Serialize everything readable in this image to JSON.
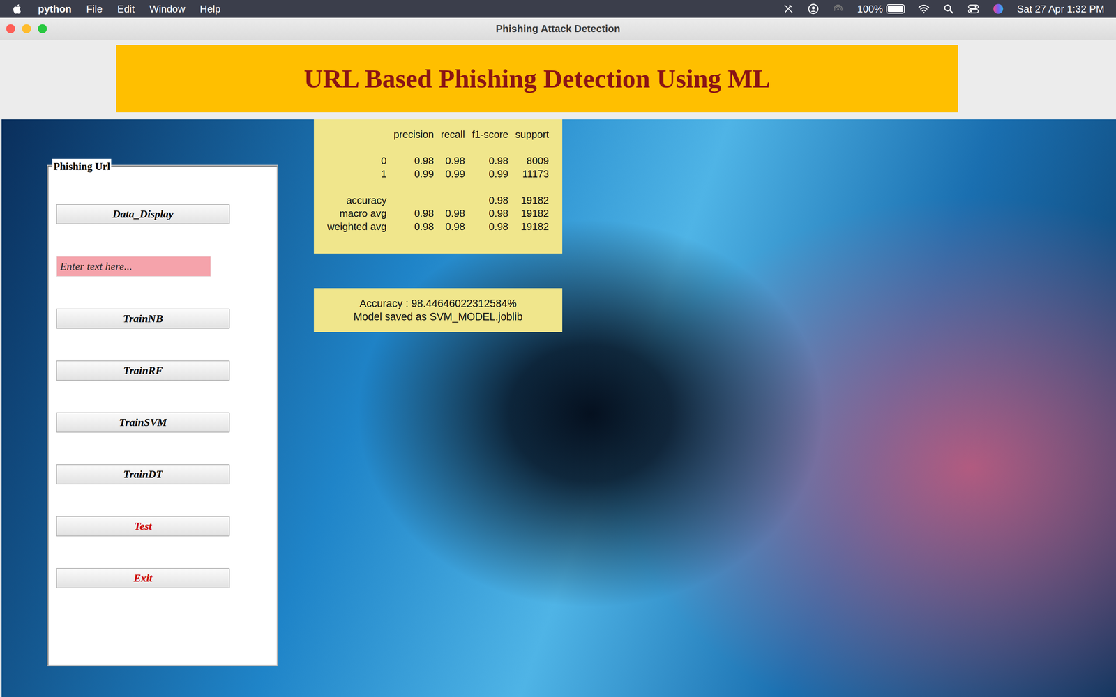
{
  "menubar": {
    "app": "python",
    "items": [
      "File",
      "Edit",
      "Window",
      "Help"
    ],
    "battery": {
      "reading": "100%",
      "level": 1
    },
    "clock": "Sat 27 Apr 1:32 PM"
  },
  "window": {
    "title": "Phishing Attack Detection"
  },
  "banner": {
    "title": "URL Based Phishing Detection Using ML"
  },
  "panel": {
    "title": "Phishing Url",
    "controls": [
      {
        "kind": "button",
        "label": "Data_Display",
        "color": "#000000"
      },
      {
        "kind": "entry",
        "placeholder": "Enter text here..."
      },
      {
        "kind": "button",
        "label": "TrainNB",
        "color": "#000000"
      },
      {
        "kind": "button",
        "label": "TrainRF",
        "color": "#000000"
      },
      {
        "kind": "button",
        "label": "TrainSVM",
        "color": "#000000"
      },
      {
        "kind": "button",
        "label": "TrainDT",
        "color": "#000000"
      },
      {
        "kind": "button",
        "label": "Test",
        "color": "#cc0000"
      },
      {
        "kind": "button",
        "label": "Exit",
        "color": "#cc0000"
      }
    ]
  },
  "report": {
    "columns": [
      "precision",
      "recall",
      "f1-score",
      "support"
    ],
    "classes": [
      {
        "label": "0",
        "values": [
          "0.98",
          "0.98",
          "0.98",
          "8009"
        ]
      },
      {
        "label": "1",
        "values": [
          "0.99",
          "0.99",
          "0.99",
          "11173"
        ]
      }
    ],
    "summary": [
      {
        "label": "accuracy",
        "values": [
          "",
          "",
          "0.98",
          "19182"
        ]
      },
      {
        "label": "macro avg",
        "values": [
          "0.98",
          "0.98",
          "0.98",
          "19182"
        ]
      },
      {
        "label": "weighted avg",
        "values": [
          "0.98",
          "0.98",
          "0.98",
          "19182"
        ]
      }
    ]
  },
  "result": {
    "lines": [
      "Accuracy : 98.44646022312584%",
      "Model saved as SVM_MODEL.joblib"
    ]
  }
}
